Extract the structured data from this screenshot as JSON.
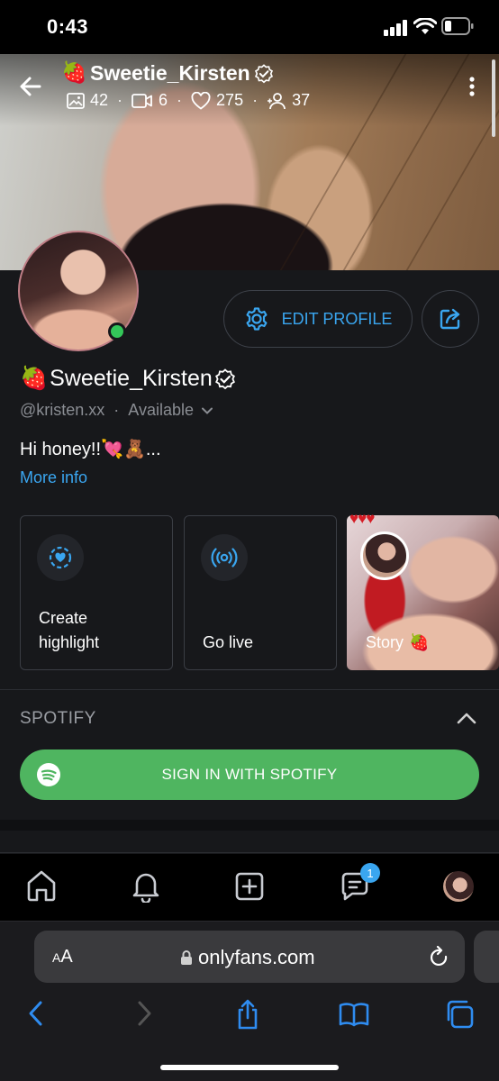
{
  "status_bar": {
    "time": "0:43"
  },
  "profile": {
    "display_name": "Sweetie_Kirsten",
    "name_emoji": "🍓",
    "handle": "@kristen.xx",
    "availability": "Available",
    "bio": "Hi honey!!💘🧸...",
    "more_info": "More info",
    "stats": {
      "photos": "42",
      "videos": "6",
      "likes": "275",
      "fans": "37"
    }
  },
  "actions": {
    "edit_profile": "EDIT PROFILE"
  },
  "cards": {
    "highlight": [
      "Create",
      "highlight"
    ],
    "live": "Go live",
    "story": "Story",
    "story_emoji": "🍓",
    "story_hearts": "♥♥♥"
  },
  "spotify": {
    "section_title": "SPOTIFY",
    "signin": "SIGN IN WITH SPOTIFY"
  },
  "nav": {
    "messages_badge": "1"
  },
  "browser": {
    "aa_small": "A",
    "aa_large": "A",
    "url": "onlyfans.com"
  },
  "colors": {
    "accent": "#3aa6f0",
    "spotify_green": "#4fb560",
    "online": "#34c759",
    "background": "#17181b"
  }
}
